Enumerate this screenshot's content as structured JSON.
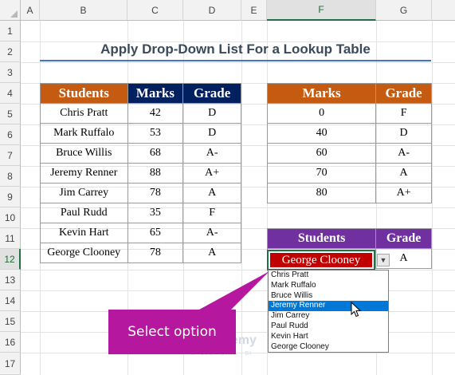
{
  "columns": [
    "A",
    "B",
    "C",
    "D",
    "E",
    "F",
    "G"
  ],
  "rows": [
    "1",
    "2",
    "3",
    "4",
    "5",
    "6",
    "7",
    "8",
    "9",
    "10",
    "11",
    "12",
    "13",
    "14",
    "15",
    "16",
    "17"
  ],
  "selected_column": "F",
  "selected_row": "12",
  "title": "Apply Drop-Down List For a Lookup Table",
  "students_table": {
    "headers": [
      "Students",
      "Marks",
      "Grade"
    ],
    "rows": [
      [
        "Chris Pratt",
        "42",
        "D"
      ],
      [
        "Mark Ruffalo",
        "53",
        "D"
      ],
      [
        "Bruce Willis",
        "68",
        "A-"
      ],
      [
        "Jeremy Renner",
        "88",
        "A+"
      ],
      [
        "Jim Carrey",
        "78",
        "A"
      ],
      [
        "Paul Rudd",
        "35",
        "F"
      ],
      [
        "Kevin Hart",
        "65",
        "A-"
      ],
      [
        "George Clooney",
        "78",
        "A"
      ]
    ]
  },
  "lookup_table": {
    "headers": [
      "Marks",
      "Grade"
    ],
    "rows": [
      [
        "0",
        "F"
      ],
      [
        "40",
        "D"
      ],
      [
        "60",
        "A-"
      ],
      [
        "70",
        "A"
      ],
      [
        "80",
        "A+"
      ]
    ]
  },
  "result_table": {
    "headers": [
      "Students",
      "Grade"
    ],
    "selected_value": "George Clooney",
    "grade": "A"
  },
  "dropdown": {
    "options": [
      "Chris Pratt",
      "Mark Ruffalo",
      "Bruce Willis",
      "Jeremy Renner",
      "Jim Carrey",
      "Paul Rudd",
      "Kevin Hart",
      "George Clooney"
    ],
    "highlighted_index": 3
  },
  "callout": {
    "text": "Select option",
    "color": "#b5179e"
  },
  "watermark": {
    "brand": "exceldemy",
    "tagline": "EXCEL · DATA · BI"
  },
  "colors": {
    "navy_header": "#002060",
    "orange_header": "#c55a11",
    "purple_header": "#7030a0",
    "selected_fill": "#c00000",
    "title_underline": "#4472c4",
    "highlight": "#0078d7"
  },
  "icons": [
    "dropdown-arrow-icon",
    "mouse-pointer-icon",
    "exceldemy-logo-icon"
  ]
}
